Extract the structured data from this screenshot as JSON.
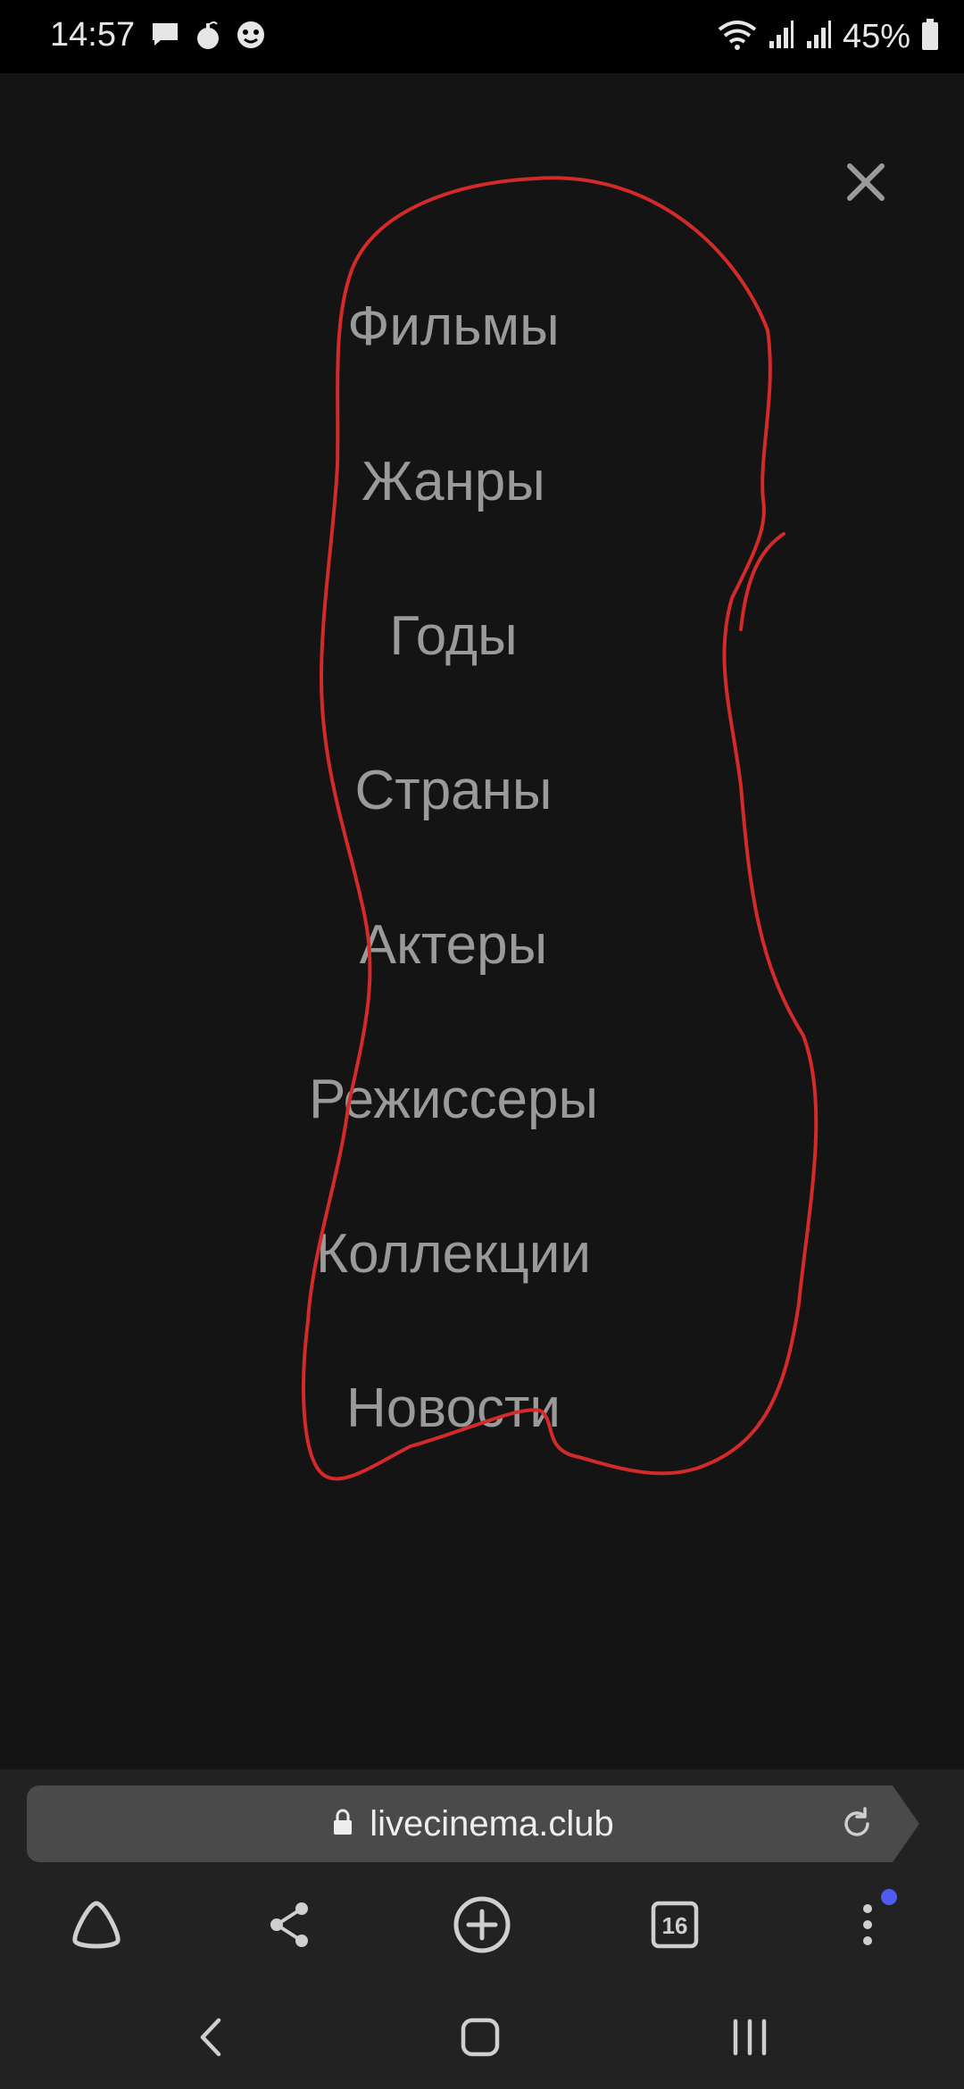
{
  "status_bar": {
    "time": "14:57",
    "battery_percent": "45%",
    "left_icons": [
      "message-icon",
      "bomb-icon",
      "lion-shield-icon"
    ],
    "right_icons": [
      "wifi-icon",
      "signal-icon",
      "signal-icon",
      "battery-icon"
    ]
  },
  "menu": {
    "items": [
      "Фильмы",
      "Жанры",
      "Годы",
      "Страны",
      "Актеры",
      "Режиссеры",
      "Коллекции",
      "Новости"
    ],
    "text_color": "#9a9a9a",
    "close_icon": "close-icon"
  },
  "annotation": {
    "color": "#d42a2a",
    "shape": "hand-drawn outline around menu"
  },
  "browser": {
    "url": "livecinema.club",
    "open_tabs": "16",
    "toolbar_icons": [
      "alice-icon",
      "share-icon",
      "add-tab-icon",
      "tabs-icon",
      "more-icon"
    ],
    "accent_color": "#4e5cf2"
  },
  "system_nav": {
    "icons": [
      "back-icon",
      "home-icon",
      "recents-icon"
    ]
  }
}
